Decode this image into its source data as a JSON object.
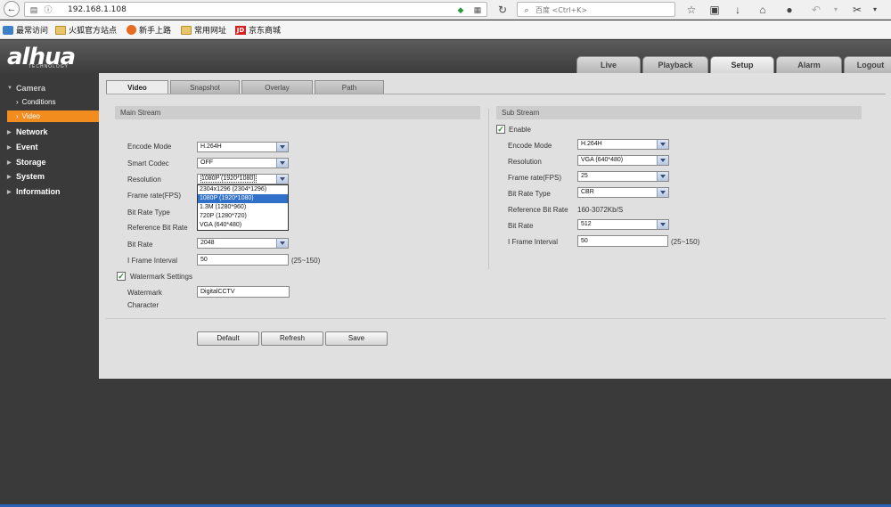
{
  "browser": {
    "url": "192.168.1.108",
    "search_placeholder": "百度 <Ctrl+K>",
    "bookmarks": [
      {
        "label": "最常访问"
      },
      {
        "label": "火狐官方站点"
      },
      {
        "label": "新手上路"
      },
      {
        "label": "常用网址"
      },
      {
        "label": "京东商城"
      }
    ]
  },
  "header": {
    "logo": "alhua",
    "logo_sub": "TECHNOLOGY",
    "tabs": [
      {
        "label": "Live"
      },
      {
        "label": "Playback"
      },
      {
        "label": "Setup"
      },
      {
        "label": "Alarm"
      },
      {
        "label": "Logout"
      }
    ]
  },
  "sidebar": {
    "camera": "Camera",
    "conditions": "Conditions",
    "video": "Video",
    "network": "Network",
    "event": "Event",
    "storage": "Storage",
    "system": "System",
    "information": "Information"
  },
  "subtabs": [
    {
      "label": "Video"
    },
    {
      "label": "Snapshot"
    },
    {
      "label": "Overlay"
    },
    {
      "label": "Path"
    }
  ],
  "main_stream": {
    "title": "Main Stream",
    "encode_mode_label": "Encode Mode",
    "encode_mode": "H.264H",
    "smart_codec_label": "Smart Codec",
    "smart_codec": "OFF",
    "resolution_label": "Resolution",
    "resolution": "1080P (1920*1080)",
    "frame_rate_label": "Frame rate(FPS)",
    "bit_rate_type_label": "Bit Rate Type",
    "reference_bit_rate_label": "Reference Bit Rate",
    "bit_rate_label": "Bit Rate",
    "bit_rate": "2048",
    "iframe_label": "I Frame Interval",
    "iframe": "50",
    "iframe_hint": "(25~150)",
    "watermark_settings": "Watermark Settings",
    "watermark_label_1": "Watermark",
    "watermark_label_2": "Character",
    "watermark": "DigitalCCTV",
    "resolution_options": [
      {
        "label": "2304x1296 (2304*1296)"
      },
      {
        "label": "1080P (1920*1080)"
      },
      {
        "label": "1.3M (1280*960)"
      },
      {
        "label": "720P (1280*720)"
      },
      {
        "label": "VGA (640*480)"
      }
    ]
  },
  "sub_stream": {
    "title": "Sub Stream",
    "enable_label": "Enable",
    "encode_mode_label": "Encode Mode",
    "encode_mode": "H.264H",
    "resolution_label": "Resolution",
    "resolution": "VGA (640*480)",
    "frame_rate_label": "Frame rate(FPS)",
    "frame_rate": "25",
    "bit_rate_type_label": "Bit Rate Type",
    "bit_rate_type": "CBR",
    "reference_bit_rate_label": "Reference Bit Rate",
    "reference_bit_rate": "160-3072Kb/S",
    "bit_rate_label": "Bit Rate",
    "bit_rate": "512",
    "iframe_label": "I Frame Interval",
    "iframe": "50",
    "iframe_hint": "(25~150)"
  },
  "buttons": {
    "default": "Default",
    "refresh": "Refresh",
    "save": "Save"
  },
  "colors": {
    "accent": "#f28c1e",
    "selected_option": "#3070c8"
  }
}
